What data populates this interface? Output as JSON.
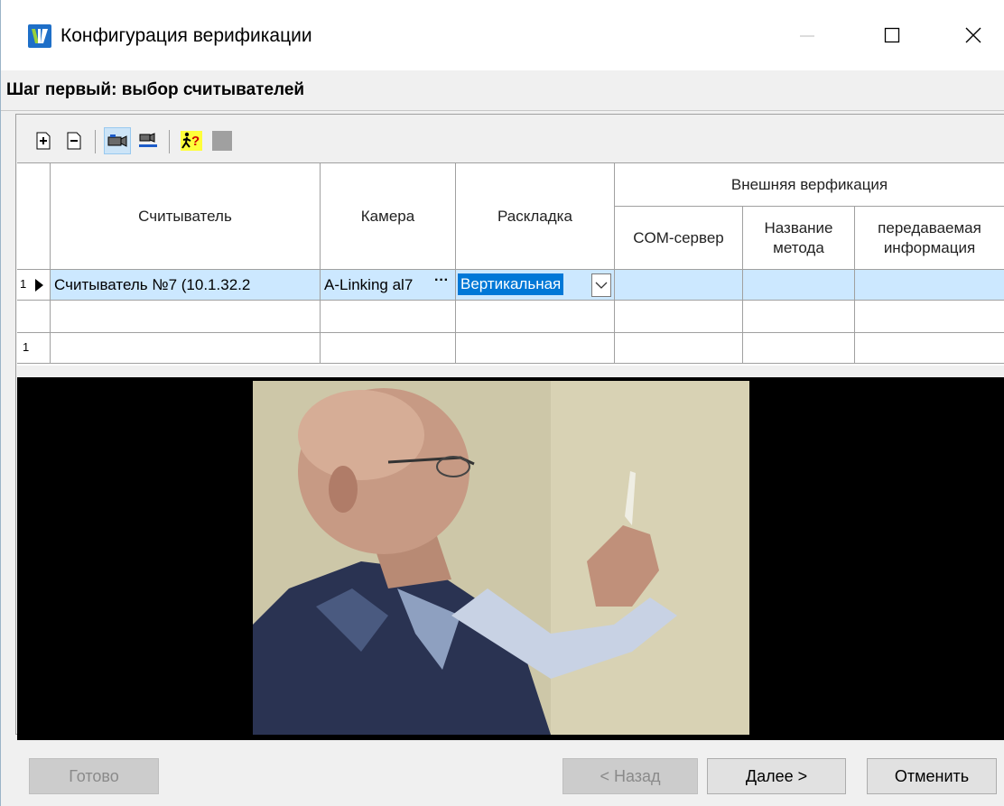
{
  "window": {
    "title": "Конфигурация верификации",
    "controls": {
      "minimize_icon": "minimize-icon",
      "maximize_icon": "maximize-icon",
      "close_icon": "close-icon"
    }
  },
  "step_heading": "Шаг первый: выбор считывателей",
  "toolbar": {
    "buttons": [
      {
        "icon": "add-row-icon",
        "active": false
      },
      {
        "icon": "remove-row-icon",
        "active": false
      },
      {
        "icon": "camera-view-icon",
        "active": true
      },
      {
        "icon": "camera-list-icon",
        "active": false
      },
      {
        "icon": "verification-help-icon",
        "active": false
      },
      {
        "icon": "gray-square-icon",
        "active": false
      }
    ]
  },
  "grid": {
    "columns": {
      "reader": "Считыватель",
      "camera": "Камера",
      "layout": "Раскладка",
      "external_group": "Внешняя верфикация",
      "com_server": "COM-сервер",
      "method_name_line1": "Название",
      "method_name_line2": "метода",
      "transmitted_info_line1": "передаваемая",
      "transmitted_info_line2": "информация"
    },
    "rows": [
      {
        "indicator": "1",
        "reader": "Считыватель №7 (10.1.32.2",
        "camera": "A-Linking al7",
        "layout": "Вертикальная",
        "com_server": "",
        "method_name": "",
        "transmitted_info": ""
      }
    ],
    "footer_row_indicator": "1"
  },
  "buttons": {
    "finish": "Готово",
    "back": "< Назад",
    "next": "Далее >",
    "cancel": "Отменить"
  },
  "colors": {
    "selection_row": "#cce8ff",
    "editor_highlight": "#0078d7",
    "video_background": "#000000"
  }
}
